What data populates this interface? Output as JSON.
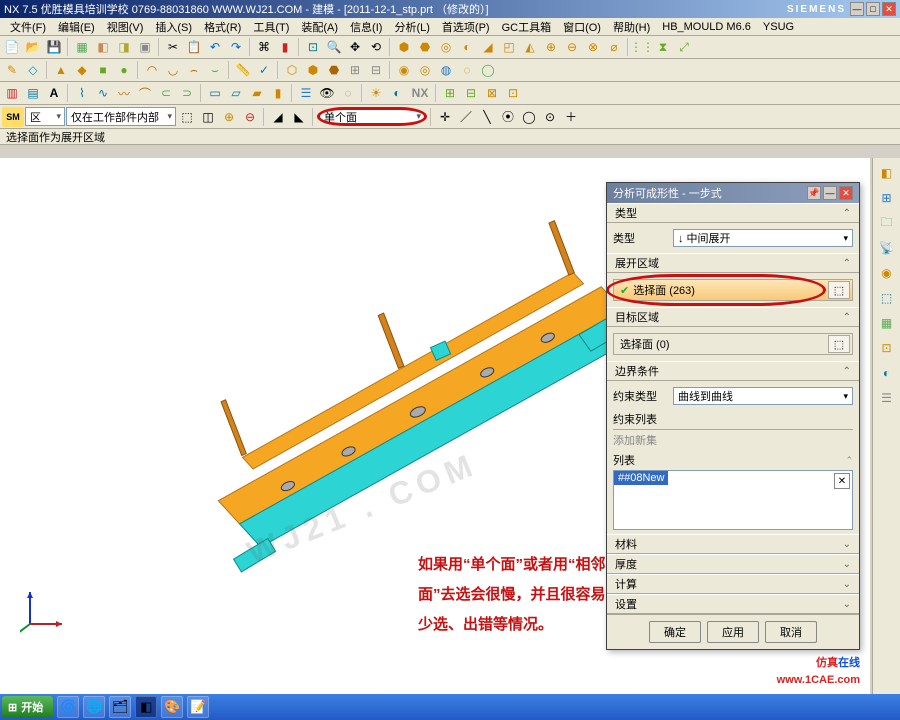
{
  "title": "NX 7.5 优胜模具培训学校 0769-88031860  WWW.WJ21.COM - 建模 - [2011-12-1_stp.prt （修改的）]",
  "brand": "SIEMENS",
  "menus": [
    "文件(F)",
    "编辑(E)",
    "视图(V)",
    "插入(S)",
    "格式(R)",
    "工具(T)",
    "装配(A)",
    "信息(I)",
    "分析(L)",
    "首选项(P)",
    "GC工具箱",
    "窗口(O)",
    "帮助(H)",
    "HB_MOULD M6.6",
    "YSUG"
  ],
  "selection_filter": {
    "left": "区",
    "middle": "仅在工作部件内部",
    "combo_circled": "单个面"
  },
  "status_msg": "选择面作为展开区域",
  "annotation": "如果用“单个面”或者用“相邻面”去选会很慢，并且很容易少选、出错等情况。",
  "watermark": "WJ21 . COM",
  "watermark2_a": "仿真",
  "watermark2_b": "在线",
  "watermark3": "www.1CAE.com",
  "dialog": {
    "title": "分析可成形性 - 一步式",
    "groups": {
      "type_h": "类型",
      "type_label": "类型",
      "type_value": "↓ 中间展开",
      "zone_h": "展开区域",
      "zone_sel": "选择面 (263)",
      "target_h": "目标区域",
      "target_sel": "选择面 (0)",
      "boundary_h": "边界条件",
      "cons_type_label": "约束类型",
      "cons_type_value": "曲线到曲线",
      "cons_list_label": "约束列表",
      "add_new": "添加新集",
      "list_label": "列表",
      "list_item": "##08New",
      "material_h": "材料",
      "thick_h": "厚度",
      "mesh_h": "计算",
      "settings_h": "设置"
    },
    "buttons": {
      "ok": "确定",
      "apply": "应用",
      "cancel": "取消"
    }
  },
  "taskbar": {
    "start": "开始"
  }
}
